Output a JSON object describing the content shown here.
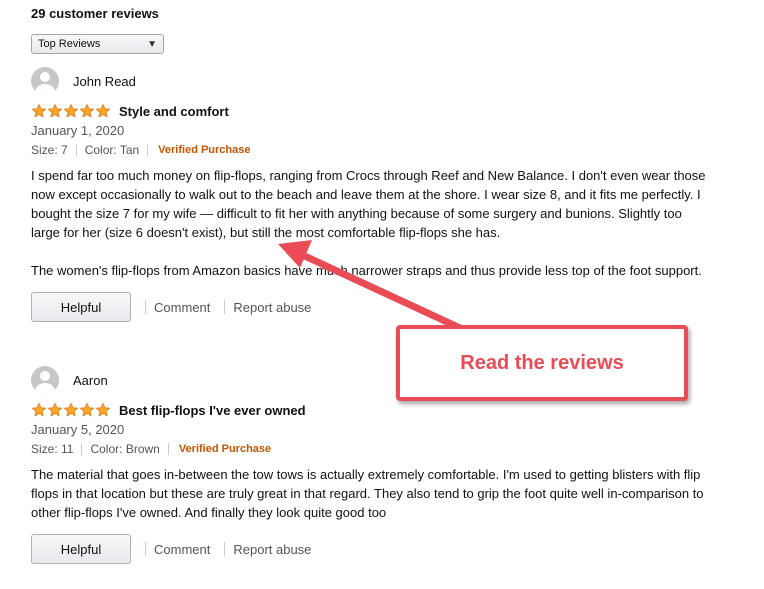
{
  "reviews_header": {
    "count_text": "29 customer reviews",
    "sort_select": {
      "value": "Top Reviews",
      "icon": "chevron-down-icon"
    }
  },
  "reviews": [
    {
      "author": "John Read",
      "rating": 5,
      "title": "Style and comfort",
      "date": "January 1, 2020",
      "size": "Size: 7",
      "color": "Color: Tan",
      "verified": "Verified Purchase",
      "body": [
        "I spend far too much money on flip-flops, ranging from Crocs through Reef and New Balance. I don't even wear those now except occasionally to walk out to the beach and leave them at the shore. I wear size 8, and it fits me perfectly. I bought the size 7 for my wife — difficult to fit her with anything because of some surgery and bunions. Slightly too large for her (size 6 doesn't exist), but still the most comfortable flip-flops she has.",
        "The women's flip-flops from Amazon basics have much narrower straps and thus provide less top of the foot support."
      ],
      "helpful_label": "Helpful",
      "comment_label": "Comment",
      "report_label": "Report abuse"
    },
    {
      "author": "Aaron",
      "rating": 5,
      "title": "Best flip-flops I've ever owned",
      "date": "January 5, 2020",
      "size": "Size: 11",
      "color": "Color: Brown",
      "verified": "Verified Purchase",
      "body": [
        "The material that goes in-between the tow tows is actually extremely comfortable. I'm used to getting blisters with flip flops in that location but these are truly great in that regard. They also tend to grip the foot quite well in-comparison to other flip-flops I've owned. And finally they look quite good too"
      ],
      "helpful_label": "Helpful",
      "comment_label": "Comment",
      "report_label": "Report abuse"
    }
  ],
  "callout": {
    "text": "Read the reviews"
  },
  "colors": {
    "star": "#f5a623",
    "star_outline": "#de7921",
    "verified": "#c45500",
    "callout": "#e94c55"
  }
}
